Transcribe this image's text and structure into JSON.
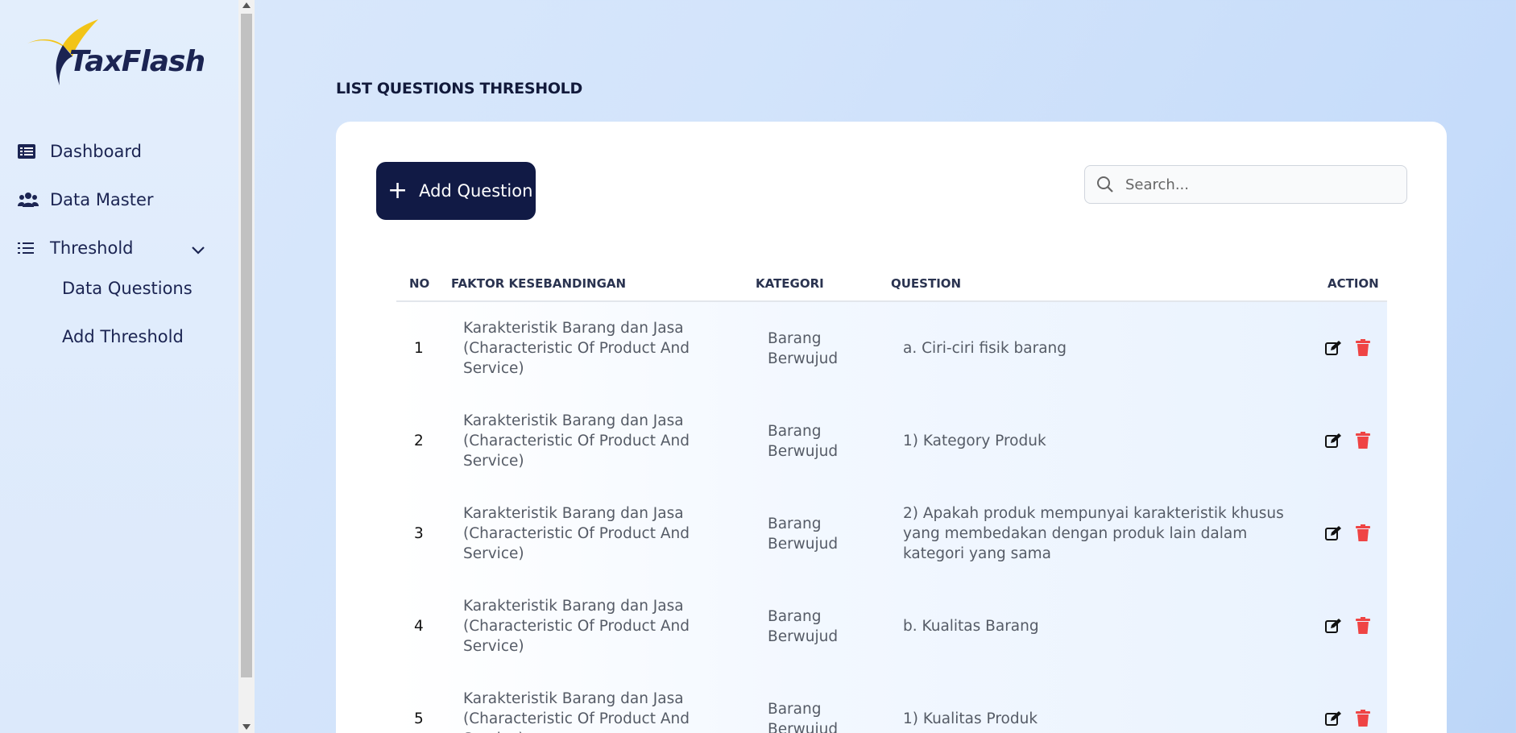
{
  "app": {
    "brand": "TaxFlash",
    "accent": "#111a45",
    "danger": "#ef4444"
  },
  "sidebar": {
    "items": [
      {
        "label": "Dashboard",
        "icon": "list-alt-icon"
      },
      {
        "label": "Data Master",
        "icon": "users-icon"
      },
      {
        "label": "Threshold",
        "icon": "list-icon",
        "expanded": true
      }
    ],
    "sub_items": [
      {
        "label": "Data Questions"
      },
      {
        "label": "Add Threshold"
      }
    ]
  },
  "page": {
    "title": "LIST QUESTIONS THRESHOLD",
    "add_button": "Add Question",
    "search_placeholder": "Search..."
  },
  "table": {
    "headers": {
      "no": "NO",
      "faktor": "FAKTOR KESEBANDINGAN",
      "kategori": "KATEGORI",
      "question": "QUESTION",
      "action": "ACTION"
    },
    "rows": [
      {
        "no": "1",
        "faktor": "Karakteristik Barang dan Jasa (Characteristic Of Product And Service)",
        "kategori": "Barang Berwujud",
        "question": "a. Ciri-ciri fisik barang"
      },
      {
        "no": "2",
        "faktor": "Karakteristik Barang dan Jasa (Characteristic Of Product And Service)",
        "kategori": "Barang Berwujud",
        "question": "1) Kategory Produk"
      },
      {
        "no": "3",
        "faktor": "Karakteristik Barang dan Jasa (Characteristic Of Product And Service)",
        "kategori": "Barang Berwujud",
        "question": "2) Apakah produk mempunyai karakteristik khusus yang membedakan dengan produk lain dalam kategori yang sama"
      },
      {
        "no": "4",
        "faktor": "Karakteristik Barang dan Jasa (Characteristic Of Product And Service)",
        "kategori": "Barang Berwujud",
        "question": "b. Kualitas Barang"
      },
      {
        "no": "5",
        "faktor": "Karakteristik Barang dan Jasa (Characteristic Of Product And Service)",
        "kategori": "Barang Berwujud",
        "question": "1) Kualitas Produk"
      }
    ]
  }
}
